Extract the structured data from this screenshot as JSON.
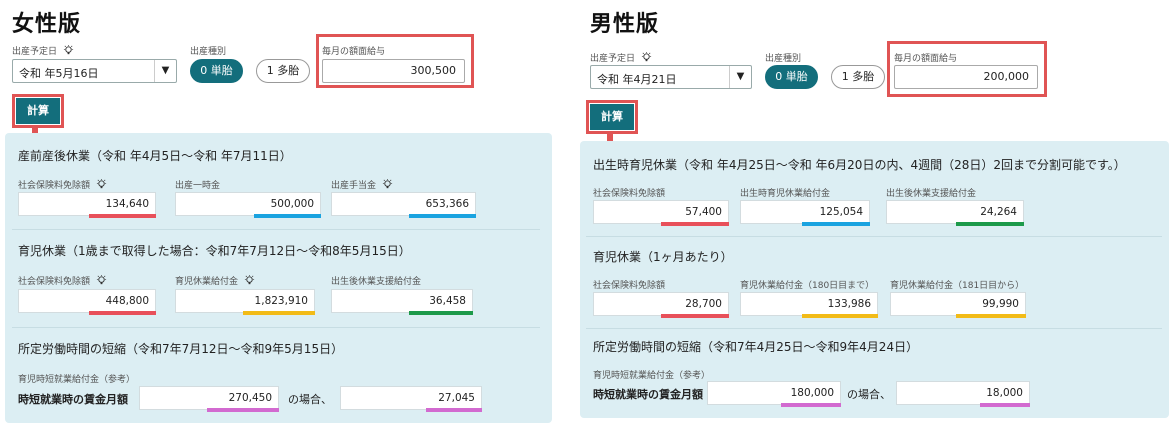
{
  "female": {
    "heading": "女性版",
    "due_date_label": "出産予定日",
    "due_date_value": "令和 年5月16日",
    "birth_type_label": "出産種別",
    "single_label": "0 単胎",
    "multiple_label": "1 多胎",
    "salary_label": "毎月の額面給与",
    "salary_value": "300,500",
    "calc_label": "計算",
    "sections": {
      "s1_title": "産前産後休業（令和 年4月5日〜令和 年7月11日）",
      "s1_f1_label": "社会保険料免除額",
      "s1_f1_value": "134,640",
      "s1_f2_label": "出産一時金",
      "s1_f2_value": "500,000",
      "s1_f3_label": "出産手当金",
      "s1_f3_value": "653,366",
      "s2_title": "育児休業（1歳まで取得した場合：令和7年7月12日〜令和8年5月15日）",
      "s2_f1_label": "社会保険料免除額",
      "s2_f1_value": "448,800",
      "s2_f2_label": "育児休業給付金",
      "s2_f2_value": "1,823,910",
      "s2_f3_label": "出生後休業支援給付金",
      "s2_f3_value": "36,458",
      "s3_title": "所定労働時間の短縮（令和7年7月12日〜令和9年5月15日）",
      "s3_sub_label": "育児時短就業給付金（参考）",
      "s3_wage_label": "時短就業時の賃金月額",
      "s3_wage_value": "270,450",
      "s3_case_label": "の場合、",
      "s3_result_value": "27,045"
    }
  },
  "male": {
    "heading": "男性版",
    "due_date_label": "出産予定日",
    "due_date_value": "令和 年4月21日",
    "birth_type_label": "出産種別",
    "single_label": "0 単胎",
    "multiple_label": "1 多胎",
    "salary_label": "毎月の額面給与",
    "salary_value": "200,000",
    "calc_label": "計算",
    "sections": {
      "s1_title": "出生時育児休業（令和 年4月25日〜令和 年6月20日の内、4週間（28日）2回まで分割可能です。）",
      "s1_f1_label": "社会保険料免除額",
      "s1_f1_value": "57,400",
      "s1_f2_label": "出生時育児休業給付金",
      "s1_f2_value": "125,054",
      "s1_f3_label": "出生後休業支援給付金",
      "s1_f3_value": "24,264",
      "s2_title": "育児休業（1ヶ月あたり）",
      "s2_f1_label": "社会保険料免除額",
      "s2_f1_value": "28,700",
      "s2_f2_label": "育児休業給付金（180日目まで）",
      "s2_f2_value": "133,986",
      "s2_f3_label": "育児休業給付金（181日目から）",
      "s2_f3_value": "99,990",
      "s3_title": "所定労働時間の短縮（令和7年4月25日〜令和9年4月24日）",
      "s3_sub_label": "育児時短就業給付金（参考）",
      "s3_wage_label": "時短就業時の賃金月額",
      "s3_wage_value": "180,000",
      "s3_case_label": "の場合、",
      "s3_result_value": "18,000"
    }
  },
  "icons": {
    "hint": "lightbulb-icon",
    "dropdown": "chevron-down-icon"
  },
  "colors": {
    "accent": "#136e7c",
    "highlight": "#e05454",
    "panel": "#dceef3",
    "red": "#e8505a",
    "blue": "#1aa3e0",
    "green": "#1d9a4a",
    "yellow": "#f2bb17",
    "pink": "#d26ad0"
  }
}
